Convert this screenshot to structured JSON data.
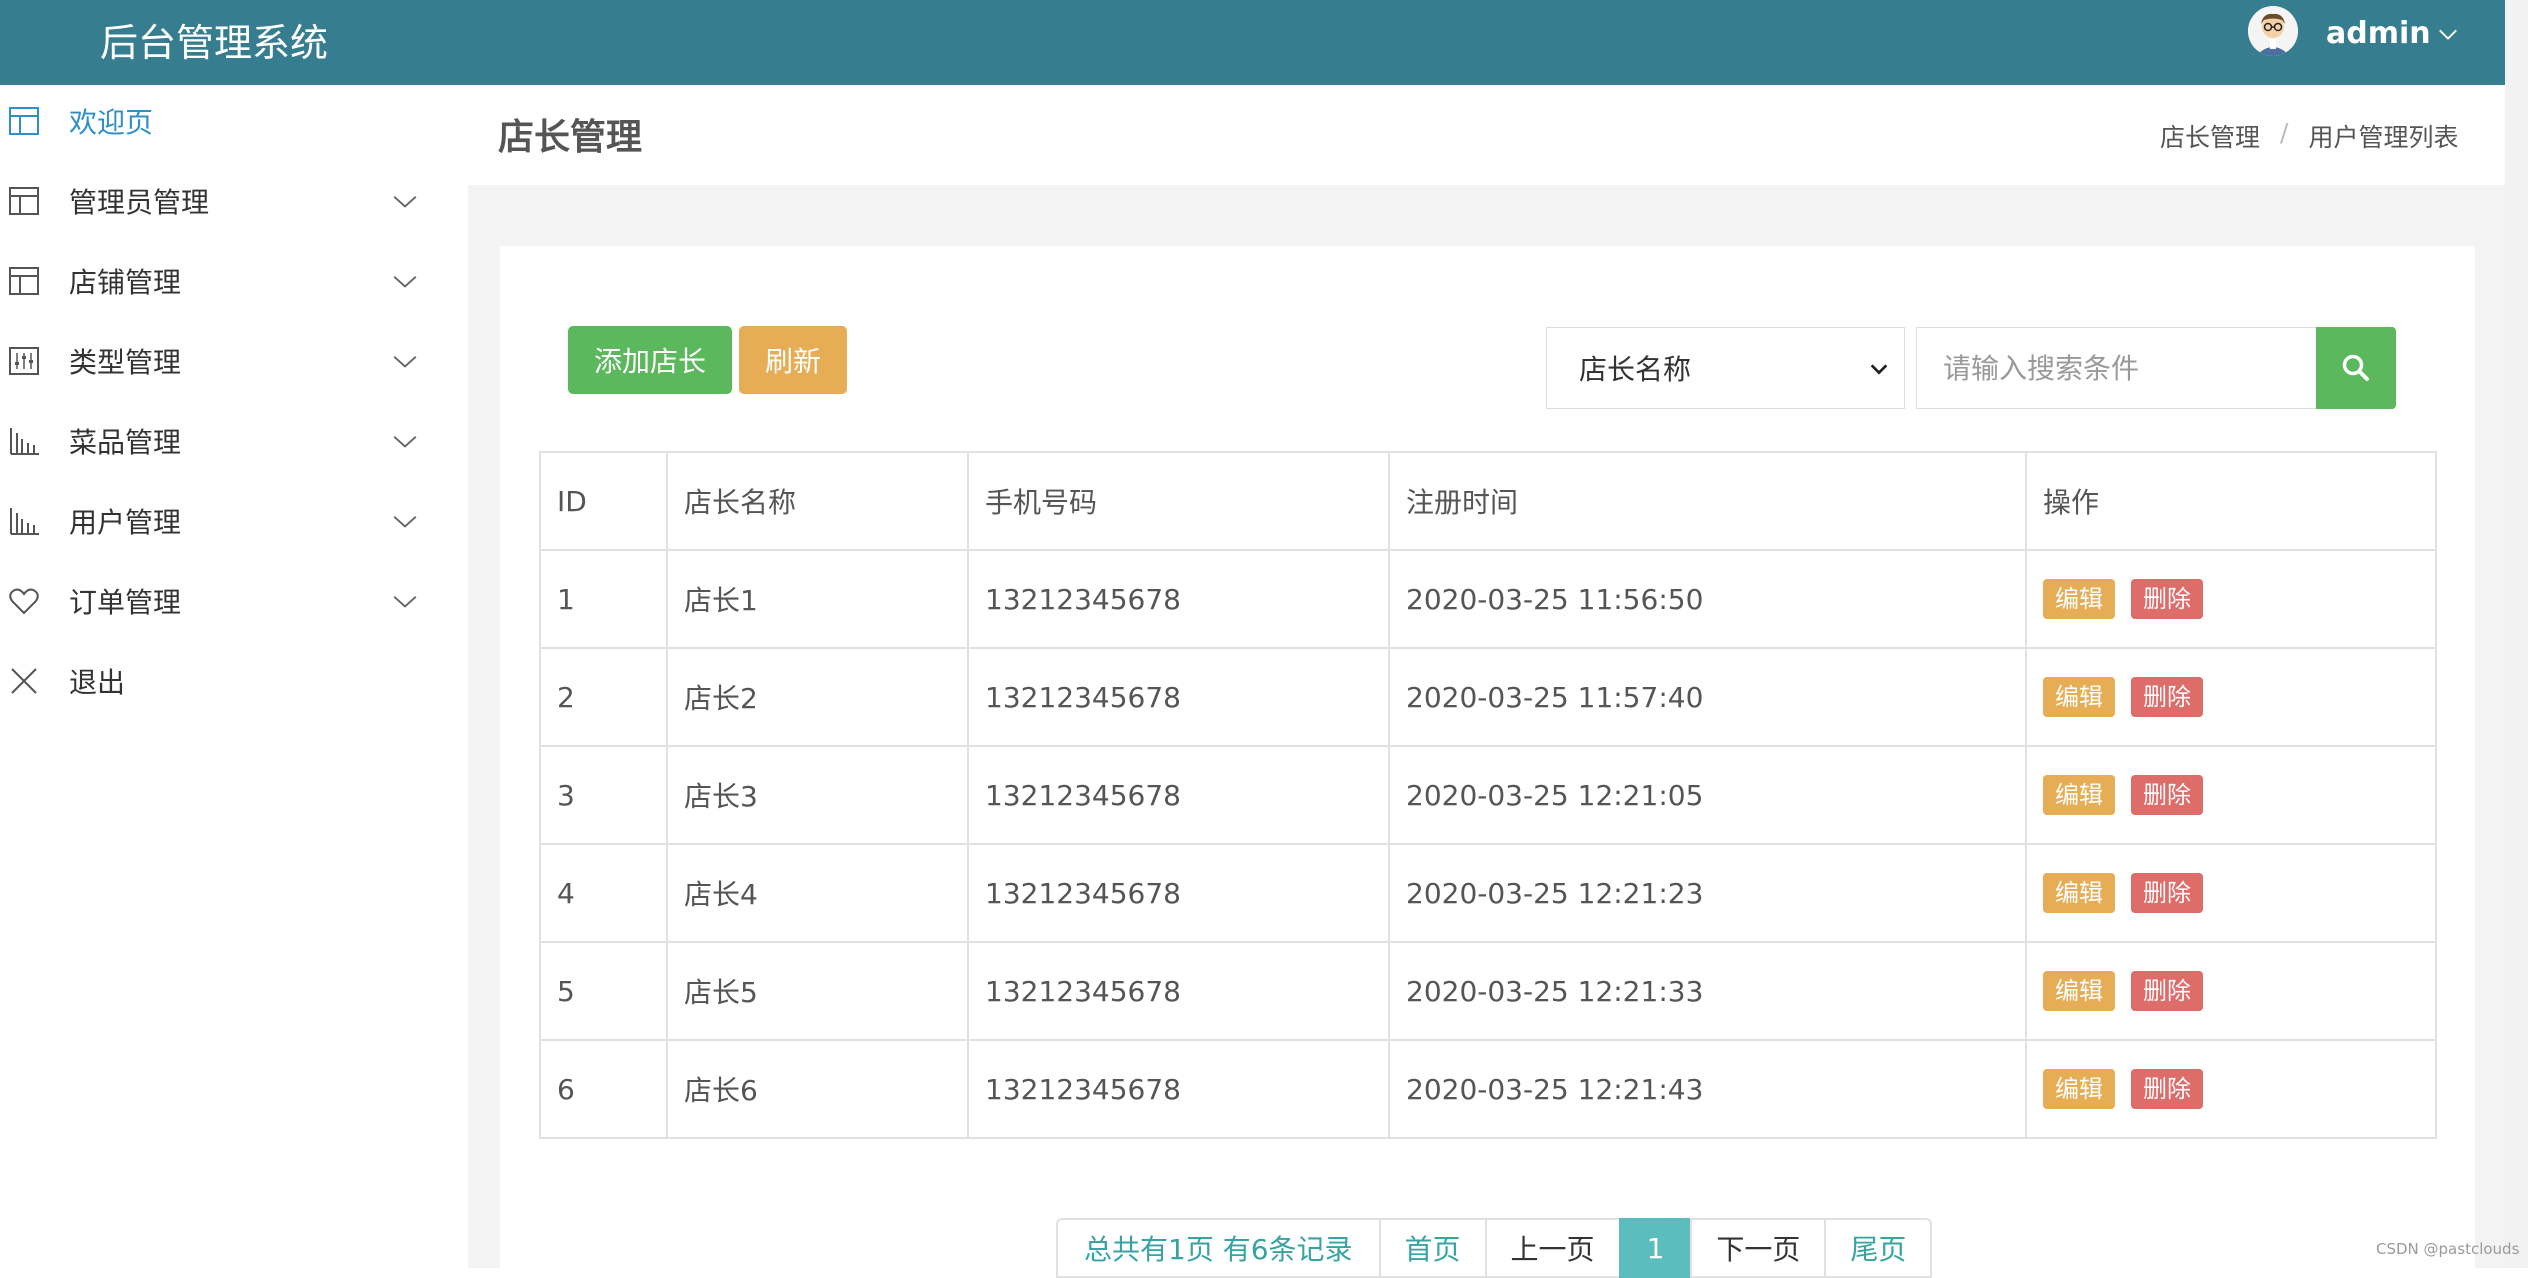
{
  "header": {
    "title": "后台管理系统",
    "user": "admin"
  },
  "sidebar": {
    "items": [
      {
        "label": "欢迎页",
        "icon": "layout-icon"
      },
      {
        "label": "管理员管理",
        "icon": "layout-icon"
      },
      {
        "label": "店铺管理",
        "icon": "layout-icon"
      },
      {
        "label": "类型管理",
        "icon": "sliders-icon"
      },
      {
        "label": "菜品管理",
        "icon": "bar-chart-icon"
      },
      {
        "label": "用户管理",
        "icon": "bar-chart-icon"
      },
      {
        "label": "订单管理",
        "icon": "heart-icon"
      },
      {
        "label": "退出",
        "icon": "close-icon"
      }
    ]
  },
  "page": {
    "title": "店长管理",
    "breadcrumb": [
      "店长管理",
      "/",
      "用户管理列表"
    ]
  },
  "toolbar": {
    "add_label": "添加店长",
    "refresh_label": "刷新",
    "select_value": "店长名称",
    "search_placeholder": "请输入搜索条件"
  },
  "table": {
    "headers": [
      "ID",
      "店长名称",
      "手机号码",
      "注册时间",
      "操作"
    ],
    "rows": [
      {
        "id": "1",
        "name": "店长1",
        "phone": "13212345678",
        "time": "2020-03-25 11:56:50"
      },
      {
        "id": "2",
        "name": "店长2",
        "phone": "13212345678",
        "time": "2020-03-25 11:57:40"
      },
      {
        "id": "3",
        "name": "店长3",
        "phone": "13212345678",
        "time": "2020-03-25 12:21:05"
      },
      {
        "id": "4",
        "name": "店长4",
        "phone": "13212345678",
        "time": "2020-03-25 12:21:23"
      },
      {
        "id": "5",
        "name": "店长5",
        "phone": "13212345678",
        "time": "2020-03-25 12:21:33"
      },
      {
        "id": "6",
        "name": "店长6",
        "phone": "13212345678",
        "time": "2020-03-25 12:21:43"
      }
    ],
    "edit_label": "编辑",
    "delete_label": "删除"
  },
  "pagination": {
    "summary": "总共有1页  有6条记录",
    "first": "首页",
    "prev": "上一页",
    "current": "1",
    "next": "下一页",
    "last": "尾页"
  },
  "watermark": "CSDN @pastclouds",
  "colors": {
    "header": "#367d8f",
    "primary": "#5cb85c",
    "warning": "#e6ad55",
    "danger": "#d9534f",
    "page_active": "#5bbdbd"
  }
}
